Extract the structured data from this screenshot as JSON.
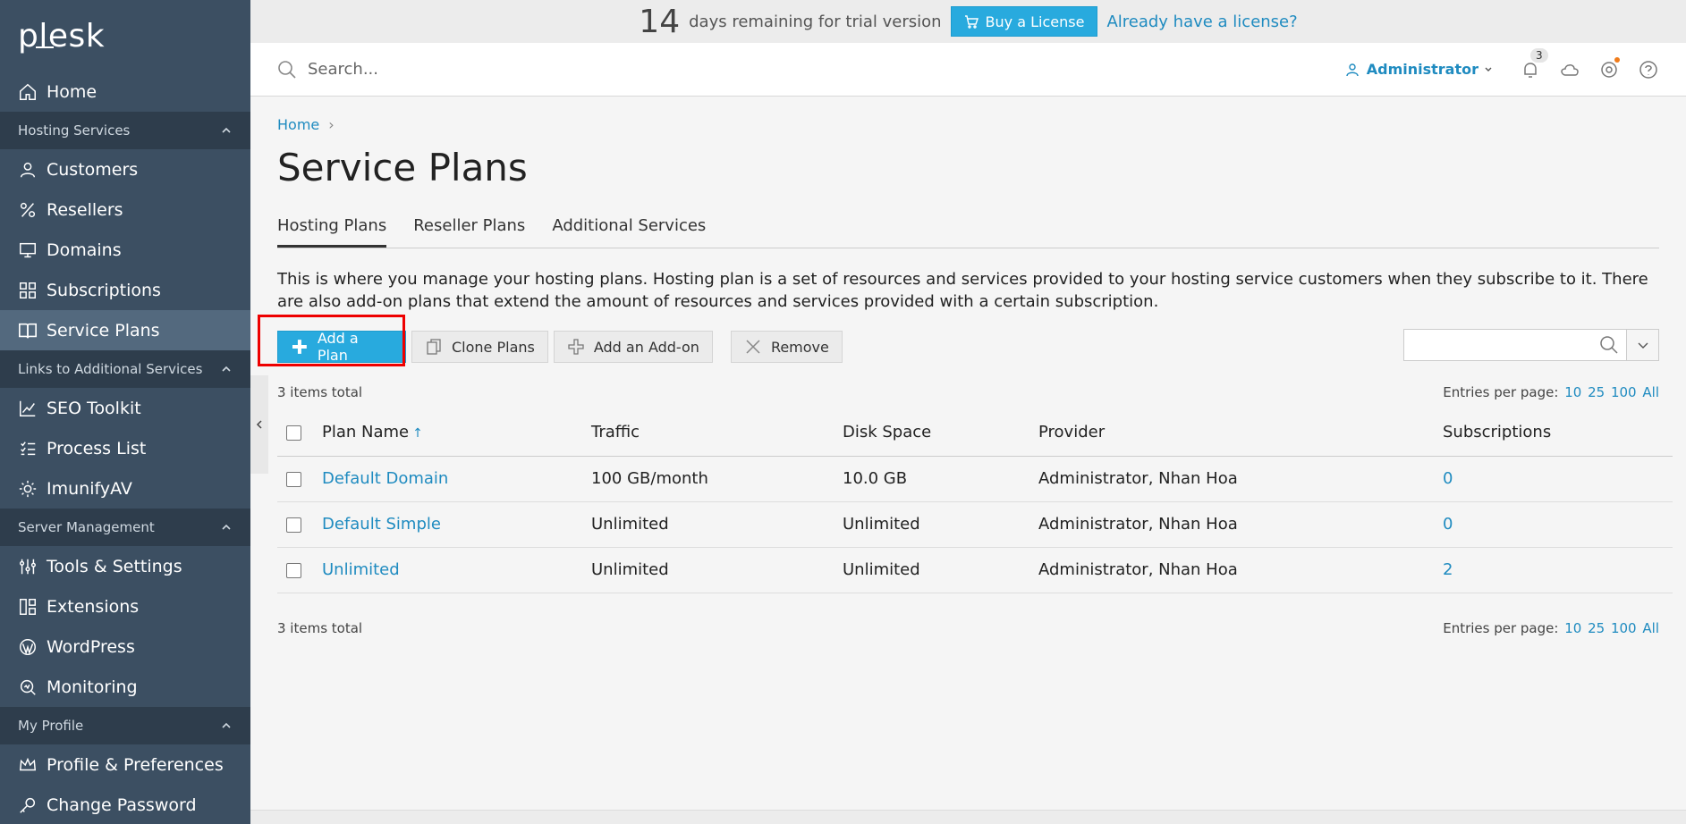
{
  "brand": {
    "logo": "plesk"
  },
  "trial": {
    "days": "14",
    "text": "days remaining for trial version",
    "buy_label": "Buy a License",
    "already_label": "Already have a license?"
  },
  "header": {
    "search_placeholder": "Search...",
    "user": "Administrator",
    "notifications_count": "3"
  },
  "sidebar": {
    "home": "Home",
    "groups": {
      "hosting": "Hosting Services",
      "links": "Links to Additional Services",
      "server": "Server Management",
      "profile": "My Profile"
    },
    "items": {
      "customers": "Customers",
      "resellers": "Resellers",
      "domains": "Domains",
      "subscriptions": "Subscriptions",
      "service_plans": "Service Plans",
      "seo": "SEO Toolkit",
      "process": "Process List",
      "imunify": "ImunifyAV",
      "tools": "Tools & Settings",
      "extensions": "Extensions",
      "wordpress": "WordPress",
      "monitoring": "Monitoring",
      "profile_prefs": "Profile & Preferences",
      "change_password": "Change Password"
    }
  },
  "page": {
    "breadcrumb_home": "Home",
    "title": "Service Plans",
    "tabs": [
      "Hosting Plans",
      "Reseller Plans",
      "Additional Services"
    ],
    "description": "This is where you manage your hosting plans. Hosting plan is a set of resources and services provided to your hosting service customers when they subscribe to it. There are also add-on plans that extend the amount of resources and services provided with a certain subscription."
  },
  "toolbar": {
    "add_plan": "Add a Plan",
    "clone_plans": "Clone Plans",
    "add_addon": "Add an Add-on",
    "remove": "Remove"
  },
  "list": {
    "items_total": "3 items total",
    "entries_label": "Entries per page:",
    "entries_options": [
      "10",
      "25",
      "100",
      "All"
    ],
    "columns": [
      "Plan Name",
      "Traffic",
      "Disk Space",
      "Provider",
      "Subscriptions"
    ],
    "sort_indicator": "↑",
    "rows": [
      {
        "name": "Default Domain",
        "traffic": "100 GB/month",
        "disk": "10.0 GB",
        "provider": "Administrator, Nhan Hoa",
        "subs": "0"
      },
      {
        "name": "Default Simple",
        "traffic": "Unlimited",
        "disk": "Unlimited",
        "provider": "Administrator, Nhan Hoa",
        "subs": "0"
      },
      {
        "name": "Unlimited",
        "traffic": "Unlimited",
        "disk": "Unlimited",
        "provider": "Administrator, Nhan Hoa",
        "subs": "2"
      }
    ]
  },
  "colors": {
    "sidebar_bg": "#3c4f62",
    "sidebar_group_bg": "#2e3d4c",
    "accent": "#28aade",
    "link": "#1f8bc0",
    "highlight": "#ee0000"
  }
}
